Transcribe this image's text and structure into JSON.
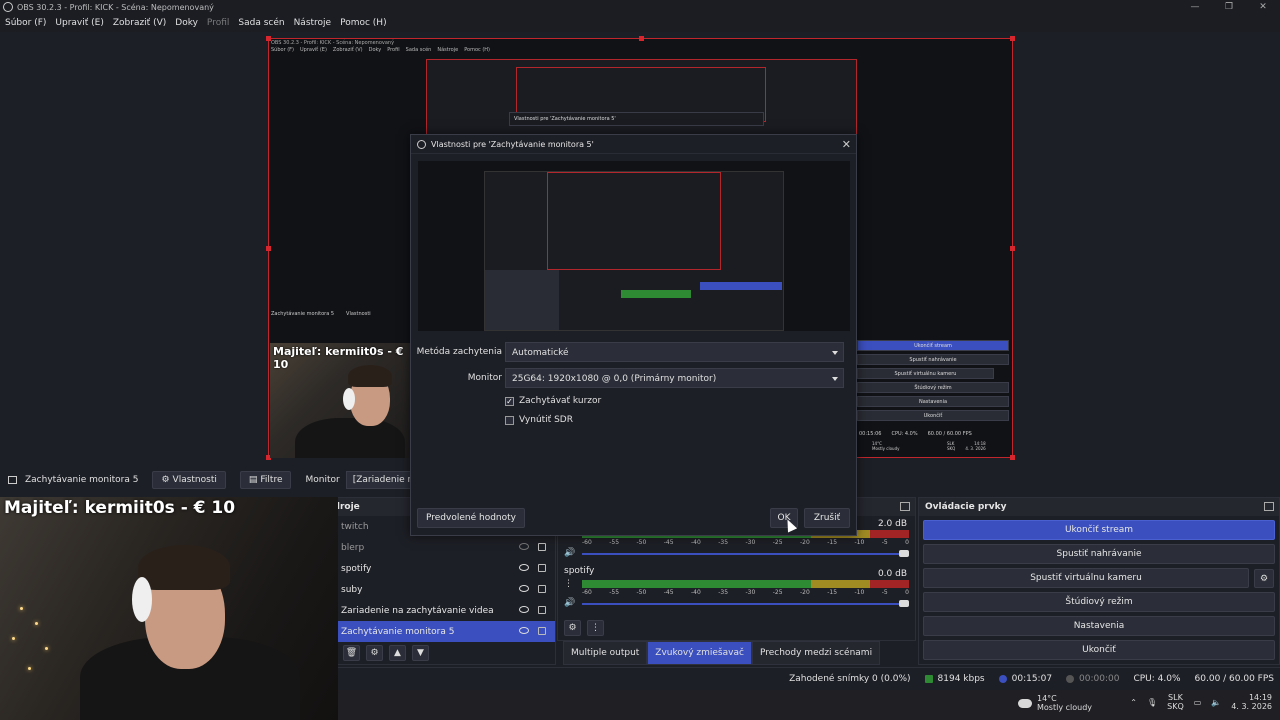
{
  "window": {
    "title": "OBS 30.2.3 - Profil: KICK - Scéna: Nepomenovaný",
    "controls": [
      "—",
      "❐",
      "✕"
    ]
  },
  "menu": [
    "Súbor (F)",
    "Upraviť (E)",
    "Zobraziť (V)",
    "Doky",
    "Profil",
    "Sada scén",
    "Nástroje",
    "Pomoc (H)"
  ],
  "preview": {
    "nested_title": "OBS 30.2.3 - Profil: KICK - Scéna: Nepomenovaný",
    "nested_menu": [
      "Súbor (F)",
      "Upraviť (E)",
      "Zobraziť (V)",
      "Doky",
      "Profil",
      "Sada scén",
      "Nástroje",
      "Pomoc (H)"
    ],
    "nested_dialog_title": "Vlastnosti pre 'Zachytávanie monitora 5'",
    "nested_toolbar": [
      "Zachytávanie monitora 5",
      "Vlastnosti"
    ],
    "cam_caption": "Majiteľ: kermiit0s - € 10",
    "nested_controls": [
      "Ukončiť stream",
      "Spustiť nahrávanie",
      "Spustiť virtuálnu kameru",
      "Štúdiový režim",
      "Nastavenia",
      "Ukončiť"
    ],
    "nested_status": [
      "00:15:06",
      "CPU: 4.0%",
      "60.00 / 60.00 FPS"
    ],
    "nested_weather": [
      "14°C",
      "Mostly cloudy"
    ],
    "nested_tray": [
      "SLK",
      "SKQ",
      "14:18",
      "4. 3. 2026"
    ]
  },
  "source_toolbar": {
    "source_name": "Zachytávanie monitora 5",
    "properties": "Vlastnosti",
    "filters": "Filtre",
    "monitor_label": "Monitor",
    "monitor_value": "[Zariadenie nie je pripojené]"
  },
  "dialog": {
    "title": "Vlastnosti pre 'Zachytávanie monitora 5'",
    "method_label": "Metóda zachytenia",
    "method_value": "Automatické",
    "monitor_label": "Monitor",
    "monitor_value": "25G64: 1920x1080 @ 0,0 (Primárny monitor)",
    "capture_cursor": "Zachytávať kurzor",
    "capture_cursor_checked": true,
    "force_sdr": "Vynútiť SDR",
    "force_sdr_checked": false,
    "defaults_button": "Predvolené hodnoty",
    "ok_button": "OK",
    "cancel_button": "Zrušiť"
  },
  "webcam": {
    "caption": "Majiteľ: kermiit0s - € 10"
  },
  "sources": {
    "title": "Zdroje",
    "items": [
      {
        "name": "twitch",
        "visible": false,
        "dim": true
      },
      {
        "name": "blerp",
        "visible": false,
        "dim": true
      },
      {
        "name": "spotify",
        "visible": true,
        "dim": false
      },
      {
        "name": "suby",
        "visible": true,
        "dim": false
      },
      {
        "name": "Zariadenie na zachytávanie videa",
        "visible": true,
        "dim": false
      },
      {
        "name": "Zachytávanie monitora 5",
        "visible": true,
        "dim": false,
        "selected": true
      }
    ]
  },
  "mixer": {
    "channels": [
      {
        "name": "",
        "db": "2.0 dB"
      },
      {
        "name": "spotify",
        "db": "0.0 dB"
      }
    ],
    "scale": [
      "-60",
      "-55",
      "-50",
      "-45",
      "-40",
      "-35",
      "-30",
      "-25",
      "-20",
      "-15",
      "-10",
      "-5",
      "0"
    ],
    "tabs": [
      "Multiple output",
      "Zvukový zmiešavač",
      "Prechody medzi scénami"
    ],
    "active_tab": 1
  },
  "controls": {
    "title": "Ovládacie prvky",
    "buttons": [
      "Ukončiť stream",
      "Spustiť nahrávanie",
      "Spustiť virtuálnu kameru",
      "Štúdiový režim",
      "Nastavenia",
      "Ukončiť"
    ]
  },
  "status": {
    "dropped": "Zahodené snímky 0 (0.0%)",
    "bitrate": "8194 kbps",
    "stream_time": "00:15:07",
    "record_time": "00:00:00",
    "cpu": "CPU: 4.0%",
    "fps": "60.00 / 60.00 FPS"
  },
  "taskbar": {
    "temp": "14°C",
    "weather": "Mostly cloudy",
    "lang1": "SLK",
    "lang2": "SKQ",
    "time": "14:19",
    "date": "4. 3. 2026"
  },
  "colors": {
    "accent": "#3b4fbe",
    "selection_border": "#c0262c",
    "meter_green": "#2f8a34",
    "meter_yellow": "#a08b23",
    "meter_red": "#a32424"
  }
}
